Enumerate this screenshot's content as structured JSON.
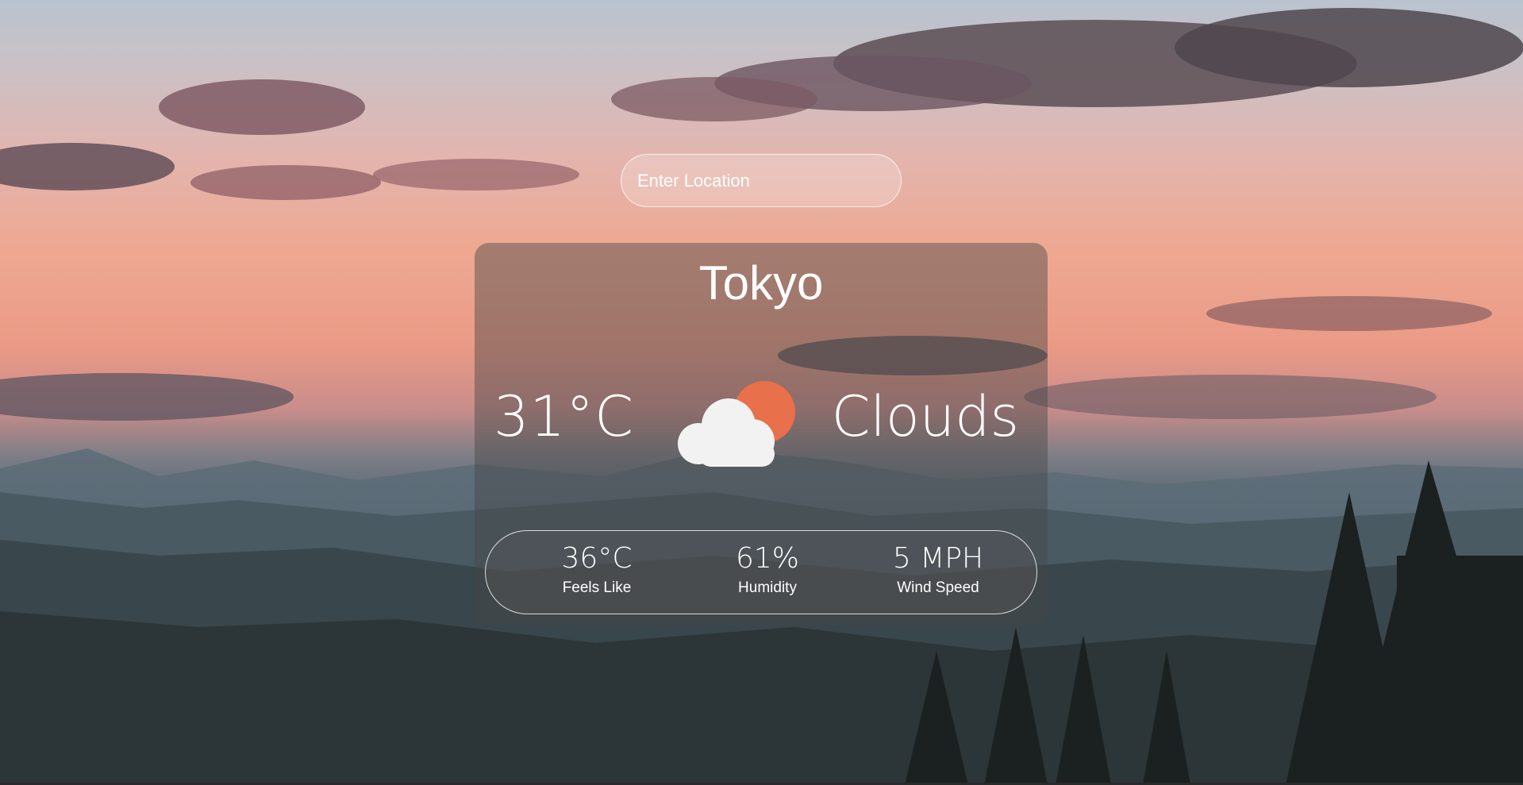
{
  "search": {
    "placeholder": "Enter Location",
    "value": ""
  },
  "weather": {
    "city": "Tokyo",
    "temperature": "31°C",
    "condition": "Clouds",
    "icon": "cloud-sun-icon"
  },
  "details": {
    "feels_like": {
      "value": "36°C",
      "label": "Feels Like"
    },
    "humidity": {
      "value": "61%",
      "label": "Humidity"
    },
    "wind_speed": {
      "value": "5 MPH",
      "label": "Wind Speed"
    }
  },
  "colors": {
    "sun": "#e8704a",
    "cloud": "#f2f2f2",
    "text": "#ffffff"
  }
}
